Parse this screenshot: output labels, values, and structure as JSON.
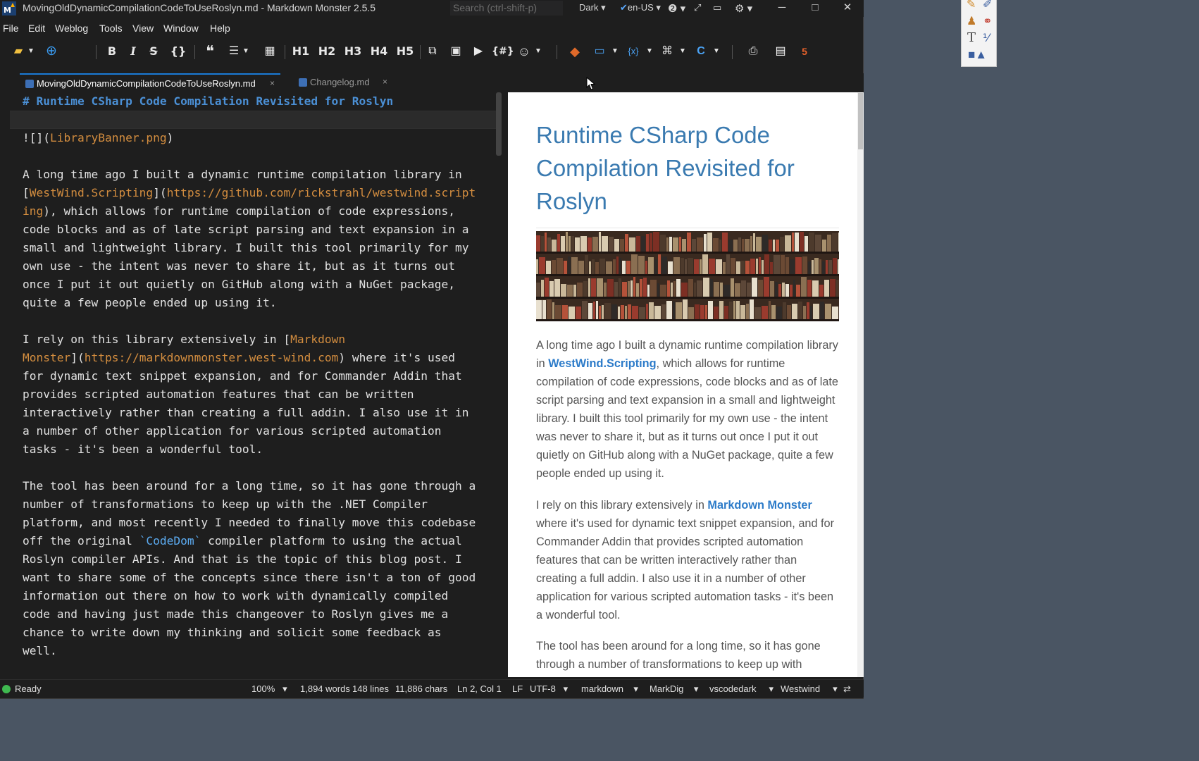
{
  "window": {
    "title": "MovingOldDynamicCompilationCodeToUseRoslyn.md  - Markdown Monster 2.5.5",
    "search_placeholder": "Search (ctrl-shift-p)",
    "theme": "Dark",
    "language": "en-US"
  },
  "menu": [
    "File",
    "Edit",
    "Weblog",
    "Tools",
    "View",
    "Window",
    "Help"
  ],
  "toolbar": {
    "bold": "B",
    "italic": "I",
    "strike": "S",
    "code": "{}",
    "h1": "H1",
    "h2": "H2",
    "h3": "H3",
    "h4": "H4",
    "h5": "H5",
    "snippet": "{#}"
  },
  "tabs": [
    {
      "label": "MovingOldDynamicCompilationCodeToUseRoslyn.md",
      "active": true
    },
    {
      "label": "Changelog.md",
      "active": false
    }
  ],
  "editor": {
    "lines": [
      [
        {
          "t": "# Runtime CSharp Code Compilation Revisited for Roslyn",
          "c": "head"
        }
      ],
      [
        {
          "t": "",
          "c": ""
        }
      ],
      [
        {
          "t": "![](",
          "c": ""
        },
        {
          "t": "LibraryBanner.png",
          "c": "link"
        },
        {
          "t": ")",
          "c": ""
        }
      ],
      [
        {
          "t": "",
          "c": ""
        }
      ],
      [
        {
          "t": "A long time ago I built a dynamic runtime compilation library in",
          "c": ""
        }
      ],
      [
        {
          "t": "[",
          "c": ""
        },
        {
          "t": "WestWind.Scripting",
          "c": "link"
        },
        {
          "t": "](",
          "c": ""
        },
        {
          "t": "https://github.com/rickstrahl/westwind.script",
          "c": "link"
        }
      ],
      [
        {
          "t": "ing",
          "c": "link"
        },
        {
          "t": "), which allows for runtime compilation of code expressions,",
          "c": ""
        }
      ],
      [
        {
          "t": "code blocks and as of late script parsing and text expansion in a",
          "c": ""
        }
      ],
      [
        {
          "t": "small and lightweight library. I built this tool primarily for my",
          "c": ""
        }
      ],
      [
        {
          "t": "own use - the intent was never to share it, but as it turns out",
          "c": ""
        }
      ],
      [
        {
          "t": "once I put it out quietly on GitHub along with a NuGet package,",
          "c": ""
        }
      ],
      [
        {
          "t": "quite a few people ended up using it.",
          "c": ""
        }
      ],
      [
        {
          "t": "",
          "c": ""
        }
      ],
      [
        {
          "t": "I rely on this library extensively in [",
          "c": ""
        },
        {
          "t": "Markdown",
          "c": "link"
        }
      ],
      [
        {
          "t": "Monster",
          "c": "link"
        },
        {
          "t": "](",
          "c": ""
        },
        {
          "t": "https://markdownmonster.west-wind.com",
          "c": "link"
        },
        {
          "t": ") where it's used",
          "c": ""
        }
      ],
      [
        {
          "t": "for dynamic text snippet expansion, and for Commander Addin that",
          "c": ""
        }
      ],
      [
        {
          "t": "provides scripted automation features that can be written",
          "c": ""
        }
      ],
      [
        {
          "t": "interactively rather than creating a full addin. I also use it in",
          "c": ""
        }
      ],
      [
        {
          "t": "a number of other application for various scripted automation",
          "c": ""
        }
      ],
      [
        {
          "t": "tasks - it's been a wonderful tool.",
          "c": ""
        }
      ],
      [
        {
          "t": "",
          "c": ""
        }
      ],
      [
        {
          "t": "The tool has been around for a long time, so it has gone through a",
          "c": ""
        }
      ],
      [
        {
          "t": "number of transformations to keep up with the .NET Compiler",
          "c": ""
        }
      ],
      [
        {
          "t": "platform, and most recently I needed to finally move this codebase",
          "c": ""
        }
      ],
      [
        {
          "t": "off the original ",
          "c": ""
        },
        {
          "t": "`CodeDom`",
          "c": "code"
        },
        {
          "t": " compiler platform to using the actual",
          "c": ""
        }
      ],
      [
        {
          "t": "Roslyn compiler APIs. And that is the topic of this blog post. I",
          "c": ""
        }
      ],
      [
        {
          "t": "want to share some of the concepts since there isn't a ton of good",
          "c": ""
        }
      ],
      [
        {
          "t": "information out there on how to work with dynamically compiled",
          "c": ""
        }
      ],
      [
        {
          "t": "code and having just made this changeover to Roslyn gives me a",
          "c": ""
        }
      ],
      [
        {
          "t": "chance to write down my thinking and solicit some feedback as",
          "c": ""
        }
      ],
      [
        {
          "t": "well.",
          "c": ""
        }
      ]
    ]
  },
  "preview": {
    "title": "Runtime CSharp Code Compilation Revisited for Roslyn",
    "p1_before": "A long time ago I built a dynamic runtime compilation library in ",
    "p1_link": "WestWind.Scripting",
    "p1_after": ", which allows for runtime compilation of code expressions, code blocks and as of late script parsing and text expansion in a small and lightweight library. I built this tool primarily for my own use - the intent was never to share it, but as it turns out once I put it out quietly on GitHub along with a NuGet package, quite a few people ended up using it.",
    "p2_before": "I rely on this library extensively in ",
    "p2_link": "Markdown Monster",
    "p2_after": " where it's used for dynamic text snippet expansion, and for Commander Addin that provides scripted automation features that can be written interactively rather than creating a full addin. I also use it in a number of other application for various scripted automation tasks - it's been a wonderful tool.",
    "p3": "The tool has been around for a long time, so it has gone through a number of transformations to keep up with"
  },
  "status": {
    "ready": "Ready",
    "zoom": "100%",
    "words": "1,894 words",
    "lines": "148 lines",
    "chars": "11,886 chars",
    "position": "Ln 2, Col 1",
    "line_ending": "LF",
    "encoding": "UTF-8",
    "mode": "markdown",
    "parser": "MarkDig",
    "editor_theme": "vscodedark",
    "preview_theme": "Westwind"
  }
}
